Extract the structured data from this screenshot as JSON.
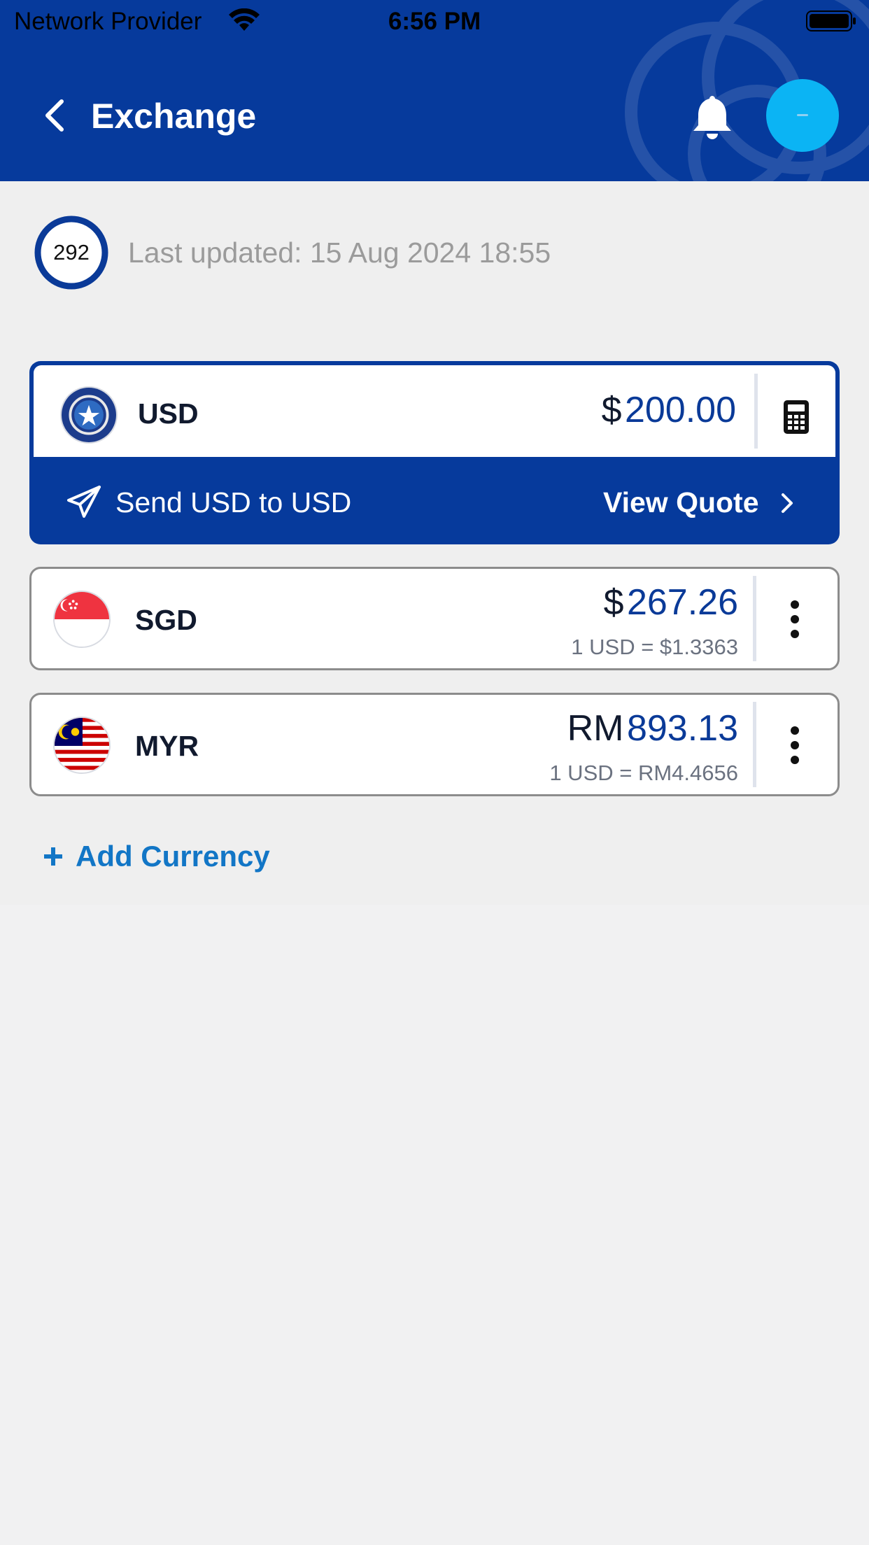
{
  "status_bar": {
    "carrier": "Network Provider",
    "time": "6:56 PM"
  },
  "header": {
    "title": "Exchange"
  },
  "refresh": {
    "countdown": "292",
    "last_updated": "Last updated: 15 Aug 2024 18:55"
  },
  "base": {
    "code": "USD",
    "symbol": "$",
    "amount": "200.00",
    "send_label": "Send USD to USD",
    "quote_label": "View Quote"
  },
  "currencies": [
    {
      "code": "SGD",
      "symbol": "$",
      "amount": "267.26",
      "rate": "1 USD = $1.3363"
    },
    {
      "code": "MYR",
      "symbol": "RM",
      "amount": "893.13",
      "rate": "1 USD = RM4.4656"
    }
  ],
  "add_currency_label": "Add Currency",
  "colors": {
    "brand": "#063a9c",
    "accent": "#0bb4f4",
    "link": "#1276c6",
    "background": "#f1f1f2"
  },
  "icons": [
    "wifi-icon",
    "battery-icon",
    "back-icon",
    "bell-icon",
    "timer-ring-icon",
    "calculator-icon",
    "send-icon",
    "chevron-right-icon",
    "more-vertical-icon",
    "plus-icon"
  ]
}
